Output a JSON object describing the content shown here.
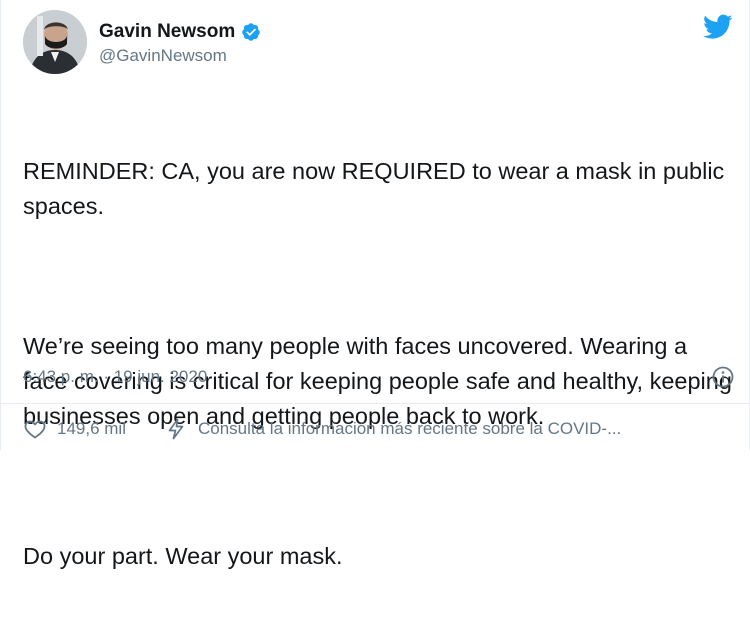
{
  "user": {
    "name": "Gavin Newsom",
    "handle": "@GavinNewsom"
  },
  "tweet": {
    "paragraphs": [
      "REMINDER: CA, you are now REQUIRED to wear a mask in public spaces.",
      "We’re seeing too many people with faces uncovered. Wearing a face covering is critical for keeping people safe and healthy, keeping businesses open and getting people back to work.",
      "Do your part. Wear your mask."
    ],
    "timestamp": "6:43 p. m. · 19 jun. 2020"
  },
  "actions": {
    "likes": "149,6 mil",
    "covid_notice": "Consulta la información más reciente sobre la COVID-..."
  },
  "colors": {
    "twitter_blue": "#1da1f2",
    "text_primary": "#14171a",
    "text_secondary": "#657786",
    "border": "#e6ecf0"
  }
}
